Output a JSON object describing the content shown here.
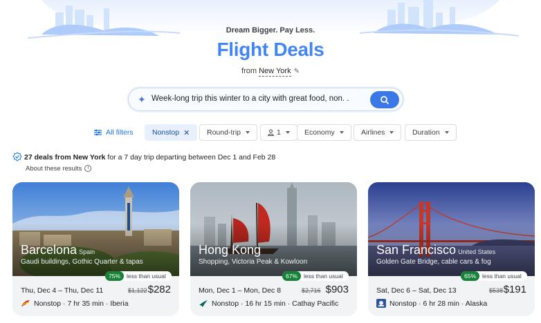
{
  "header": {
    "tagline": "Dream Bigger. Pay Less.",
    "title": "Flight Deals",
    "from_prefix": "from",
    "from_city": "New York"
  },
  "search": {
    "query": "Week-long trip this winter to a city with great food, non. ."
  },
  "filters": {
    "all_filters": "All filters",
    "nonstop": "Nonstop",
    "round_trip": "Round-trip",
    "passengers": "1",
    "cabin": "Economy",
    "airlines": "Airlines",
    "duration": "Duration"
  },
  "results": {
    "summary_bold": "27 deals from New York",
    "summary_rest": " for a 7 day trip departing between Dec 1 and Feb 28",
    "about": "About these results"
  },
  "deals": [
    {
      "city": "Barcelona",
      "country": "Spain",
      "desc": "Gaudi buildings, Gothic Quarter & tapas",
      "pct": "75%",
      "pct_label": "less than usual",
      "dates": "Thu, Dec 4 – Thu, Dec 11",
      "old_price": "$1,122",
      "price": "$282",
      "flight": "Nonstop · 7 hr 35 min · Iberia"
    },
    {
      "city": "Hong Kong",
      "country": "",
      "desc": "Shopping, Victoria Peak & Kowloon",
      "pct": "67%",
      "pct_label": "less than usual",
      "dates": "Mon, Dec 1 – Mon, Dec 8",
      "old_price": "$2,716",
      "price": "$903",
      "flight": "Nonstop · 16 hr 15 min · Cathay Pacific"
    },
    {
      "city": "San Francisco",
      "country": "United States",
      "desc": "Golden Gate Bridge, cable cars & fog",
      "pct": "65%",
      "pct_label": "less than usual",
      "dates": "Sat, Dec 6 – Sat, Dec 13",
      "old_price": "$538",
      "price": "$191",
      "flight": "Nonstop · 6 hr 28 min · Alaska"
    }
  ],
  "colors": {
    "accent": "#4285f4",
    "search_button": "#3b78e7",
    "deal_badge": "#188038"
  },
  "icons": [
    "sparkle-icon",
    "search-icon",
    "pencil-icon",
    "filter-sliders-icon",
    "close-icon",
    "person-icon",
    "chevron-down-icon",
    "badge-check-icon",
    "info-icon",
    "airline-logo-icon"
  ]
}
